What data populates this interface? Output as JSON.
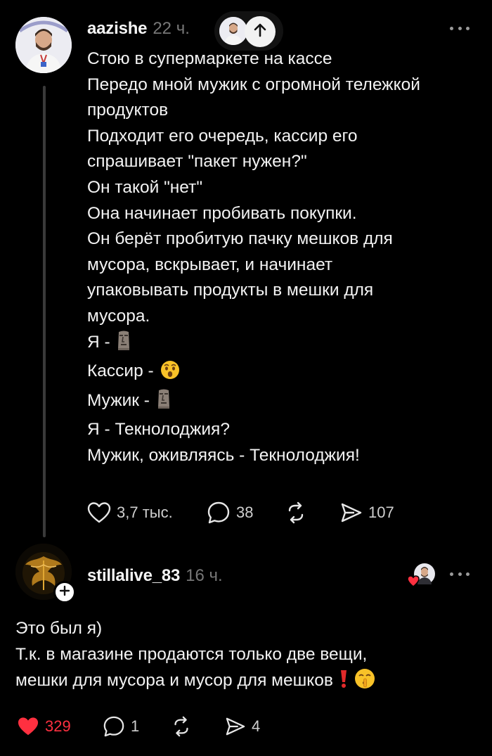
{
  "post": {
    "username": "aazishe",
    "time": "22 ч.",
    "lines": [
      "Стою в супермаркете на кассе",
      "Передо мной мужик с огромной тележкой",
      "продуктов",
      "Подходит его очередь, кассир его",
      "спрашивает \"пакет нужен?\"",
      "Он такой \"нет\"",
      "Она начинает пробивать покупки.",
      "Он берёт пробитую пачку мешков для",
      "мусора, вскрывает, и начинает",
      "упаковывать продукты в мешки для",
      "мусора."
    ],
    "emoji_lines": [
      {
        "text": "Я -",
        "emoji": "moai"
      },
      {
        "text": "Кассир -",
        "emoji": "hushed-face"
      },
      {
        "text": "Мужик -",
        "emoji": "moai"
      }
    ],
    "tail_lines": [
      "Я - Текнолоджия?",
      "Мужик, оживляясь - Текнолоджия!"
    ],
    "actions": {
      "likes": "3,7 тыс.",
      "comments": "38",
      "reposts": "",
      "shares": "107"
    }
  },
  "reply": {
    "username": "stillalive_83",
    "time": "16 ч.",
    "lines": [
      "Это был я)",
      "Т.к. в магазине продаются только две вещи,",
      "мешки для мусора и мусор для мешков"
    ],
    "trailing_emojis": [
      "exclamation-mark",
      "shushing-face"
    ],
    "actions": {
      "likes": "329",
      "comments": "1",
      "reposts": "",
      "shares": "4"
    }
  },
  "colors": {
    "background": "#000000",
    "text": "#f3f3f3",
    "muted": "#777777",
    "like_active": "#ff3040",
    "thread_line": "#3a3a3a"
  },
  "icons": {
    "like": "heart-icon",
    "comment": "comment-bubble-icon",
    "repost": "repost-arrows-icon",
    "share": "send-paper-plane-icon",
    "more": "more-dots-icon",
    "scroll_top": "arrow-up-icon",
    "follow": "plus-icon"
  }
}
